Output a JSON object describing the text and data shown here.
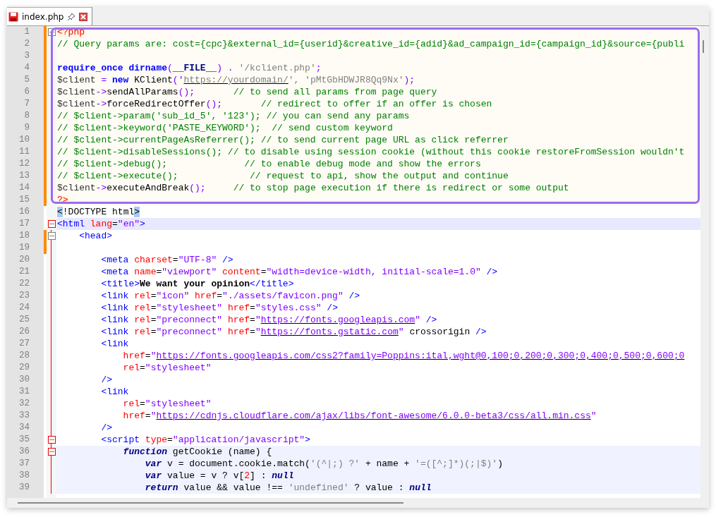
{
  "tab": {
    "label": "index.php",
    "selected": true,
    "modified": true
  },
  "editor": {
    "framed_lines": [
      {
        "num": "1",
        "changed": true,
        "current": false,
        "block": false,
        "fold": true,
        "fold_highlighted": false,
        "tokens": [
          {
            "text": "<?php",
            "kind": "php_tag"
          }
        ]
      },
      {
        "num": "2",
        "changed": true,
        "current": false,
        "block": false,
        "fold": false,
        "tokens": [
          {
            "text": "// Query params are: cost={cpc}&external_id={userid}&creative_id={adid}&ad_campaign_id={campaign_id}&source={publi",
            "kind": "comment"
          }
        ]
      },
      {
        "num": "3",
        "changed": true,
        "current": false,
        "block": false,
        "fold": false
      },
      {
        "num": "4",
        "changed": true,
        "current": false,
        "block": false,
        "fold": false,
        "tokens": [
          {
            "text": "require_once dirname",
            "kind": "kw"
          },
          {
            "text": "(",
            "kind": "op"
          },
          {
            "text": "__FILE__",
            "kind": "const"
          },
          {
            "text": ") . ",
            "kind": "op"
          },
          {
            "text": "'/kclient.php'",
            "kind": "str"
          },
          {
            "text": ";",
            "kind": "op"
          }
        ]
      },
      {
        "num": "5",
        "changed": true,
        "current": false,
        "block": false,
        "fold": false,
        "tokens": [
          {
            "text": "$client",
            "kind": "var"
          },
          {
            "text": " = ",
            "kind": "op"
          },
          {
            "text": "new",
            "kind": "kw"
          },
          {
            "text": " KClient",
            "kind": "plain"
          },
          {
            "text": "('",
            "kind": "op"
          },
          {
            "text": "https://yourdomain/",
            "kind": "str_url"
          },
          {
            "text": "', ",
            "kind": "str"
          },
          {
            "text": "'pMtGbHDWJR8Qq9Nx'",
            "kind": "str"
          },
          {
            "text": ");",
            "kind": "op"
          }
        ]
      },
      {
        "num": "6",
        "changed": true,
        "current": false,
        "block": false,
        "fold": false,
        "tokens": [
          {
            "text": "$client",
            "kind": "var"
          },
          {
            "text": "->",
            "kind": "op"
          },
          {
            "text": "sendAllParams",
            "kind": "plain"
          },
          {
            "text": "();",
            "kind": "op"
          },
          {
            "text": "       // to send all params from page query",
            "kind": "comment"
          }
        ]
      },
      {
        "num": "7",
        "changed": true,
        "current": false,
        "block": false,
        "fold": false,
        "tokens": [
          {
            "text": "$client",
            "kind": "var"
          },
          {
            "text": "->",
            "kind": "op"
          },
          {
            "text": "forceRedirectOffer",
            "kind": "plain"
          },
          {
            "text": "();",
            "kind": "op"
          },
          {
            "text": "       // redirect to offer if an offer is chosen",
            "kind": "comment"
          }
        ]
      },
      {
        "num": "8",
        "changed": true,
        "current": false,
        "block": false,
        "fold": false,
        "tokens": [
          {
            "text": "// $client->param('sub_id_5', '123'); // you can send any params",
            "kind": "comment"
          }
        ]
      },
      {
        "num": "9",
        "changed": true,
        "current": false,
        "block": false,
        "fold": false,
        "tokens": [
          {
            "text": "// $client->keyword('PASTE_KEYWORD');  // send custom keyword",
            "kind": "comment"
          }
        ]
      },
      {
        "num": "10",
        "changed": true,
        "current": false,
        "block": false,
        "fold": false,
        "tokens": [
          {
            "text": "// $client->currentPageAsReferrer(); // to send current page URL as click referrer",
            "kind": "comment"
          }
        ]
      },
      {
        "num": "11",
        "changed": true,
        "current": false,
        "block": false,
        "fold": false,
        "tokens": [
          {
            "text": "// $client->disableSessions(); // to disable using session cookie (without this cookie restoreFromSession wouldn't",
            "kind": "comment"
          }
        ]
      },
      {
        "num": "12",
        "changed": true,
        "current": false,
        "block": false,
        "fold": false,
        "tokens": [
          {
            "text": "// $client->debug();              // to enable debug mode and show the errors",
            "kind": "comment"
          }
        ]
      },
      {
        "num": "13",
        "changed": true,
        "current": false,
        "block": false,
        "fold": false,
        "tokens": [
          {
            "text": "// $client->execute();             // request to api, show the output and continue",
            "kind": "comment"
          }
        ]
      },
      {
        "num": "14",
        "changed": true,
        "current": false,
        "block": false,
        "fold": false,
        "tokens": [
          {
            "text": "$client",
            "kind": "var"
          },
          {
            "text": "->",
            "kind": "op"
          },
          {
            "text": "executeAndBreak",
            "kind": "plain"
          },
          {
            "text": "();",
            "kind": "op"
          },
          {
            "text": "     // to stop page execution if there is redirect or some output",
            "kind": "comment"
          }
        ]
      },
      {
        "num": "15",
        "changed": true,
        "current": false,
        "block": false,
        "fold": false,
        "tokens": [
          {
            "text": "?>",
            "kind": "php_tag"
          }
        ]
      }
    ],
    "lines": [
      {
        "num": "16",
        "changed": false,
        "current": false,
        "block": false,
        "fold": false,
        "tokens": [
          {
            "text": "<",
            "kind": "match"
          },
          {
            "text": "!DOCTYPE html",
            "kind": "plain"
          },
          {
            "text": ">",
            "kind": "match"
          }
        ]
      },
      {
        "num": "17",
        "changed": false,
        "current": true,
        "block": false,
        "fold": true,
        "fold_highlighted": true,
        "tokens": [
          {
            "text": "<html",
            "kind": "tag"
          },
          {
            "text": " lang",
            "kind": "attr"
          },
          {
            "text": "=",
            "kind": "plain"
          },
          {
            "text": "\"en\"",
            "kind": "val"
          },
          {
            "text": ">",
            "kind": "tag"
          }
        ]
      },
      {
        "num": "18",
        "changed": true,
        "current": false,
        "block": false,
        "fold": true,
        "fold_highlighted": false,
        "tokens": [
          {
            "text": "    <head>",
            "kind": "tag"
          }
        ]
      },
      {
        "num": "19",
        "changed": true,
        "current": false,
        "block": false,
        "fold": false
      },
      {
        "num": "20",
        "changed": false,
        "current": false,
        "block": false,
        "fold": false,
        "tokens": [
          {
            "text": "        <meta",
            "kind": "tag"
          },
          {
            "text": " charset",
            "kind": "attr"
          },
          {
            "text": "=",
            "kind": "plain"
          },
          {
            "text": "\"UTF-8\"",
            "kind": "val"
          },
          {
            "text": " />",
            "kind": "tag"
          }
        ]
      },
      {
        "num": "21",
        "changed": false,
        "current": false,
        "block": false,
        "fold": false,
        "tokens": [
          {
            "text": "        <meta",
            "kind": "tag"
          },
          {
            "text": " name",
            "kind": "attr"
          },
          {
            "text": "=",
            "kind": "plain"
          },
          {
            "text": "\"viewport\"",
            "kind": "val"
          },
          {
            "text": " content",
            "kind": "attr"
          },
          {
            "text": "=",
            "kind": "plain"
          },
          {
            "text": "\"width=device-width, initial-scale=1.0\"",
            "kind": "val"
          },
          {
            "text": " />",
            "kind": "tag"
          }
        ]
      },
      {
        "num": "22",
        "changed": false,
        "current": false,
        "block": false,
        "fold": false,
        "tokens": [
          {
            "text": "        <title>",
            "kind": "tag"
          },
          {
            "text": "We want your opinion",
            "kind": "bold"
          },
          {
            "text": "</title>",
            "kind": "tag"
          }
        ]
      },
      {
        "num": "23",
        "changed": false,
        "current": false,
        "block": false,
        "fold": false,
        "tokens": [
          {
            "text": "        <link",
            "kind": "tag"
          },
          {
            "text": " rel",
            "kind": "attr"
          },
          {
            "text": "=",
            "kind": "plain"
          },
          {
            "text": "\"icon\"",
            "kind": "val"
          },
          {
            "text": " href",
            "kind": "attr"
          },
          {
            "text": "=",
            "kind": "plain"
          },
          {
            "text": "\"./assets/favicon.png\"",
            "kind": "val"
          },
          {
            "text": " />",
            "kind": "tag"
          }
        ]
      },
      {
        "num": "24",
        "changed": false,
        "current": false,
        "block": false,
        "fold": false,
        "tokens": [
          {
            "text": "        <link",
            "kind": "tag"
          },
          {
            "text": " rel",
            "kind": "attr"
          },
          {
            "text": "=",
            "kind": "plain"
          },
          {
            "text": "\"stylesheet\"",
            "kind": "val"
          },
          {
            "text": " href",
            "kind": "attr"
          },
          {
            "text": "=",
            "kind": "plain"
          },
          {
            "text": "\"styles.css\"",
            "kind": "val"
          },
          {
            "text": " />",
            "kind": "tag"
          }
        ]
      },
      {
        "num": "25",
        "changed": false,
        "current": false,
        "block": false,
        "fold": false,
        "tokens": [
          {
            "text": "        <link",
            "kind": "tag"
          },
          {
            "text": " rel",
            "kind": "attr"
          },
          {
            "text": "=",
            "kind": "plain"
          },
          {
            "text": "\"preconnect\"",
            "kind": "val"
          },
          {
            "text": " href",
            "kind": "attr"
          },
          {
            "text": "=",
            "kind": "plain"
          },
          {
            "text": "\"",
            "kind": "val"
          },
          {
            "text": "https://fonts.googleapis.com",
            "kind": "url"
          },
          {
            "text": "\"",
            "kind": "val"
          },
          {
            "text": " />",
            "kind": "tag"
          }
        ]
      },
      {
        "num": "26",
        "changed": false,
        "current": false,
        "block": false,
        "fold": false,
        "tokens": [
          {
            "text": "        <link",
            "kind": "tag"
          },
          {
            "text": " rel",
            "kind": "attr"
          },
          {
            "text": "=",
            "kind": "plain"
          },
          {
            "text": "\"preconnect\"",
            "kind": "val"
          },
          {
            "text": " href",
            "kind": "attr"
          },
          {
            "text": "=",
            "kind": "plain"
          },
          {
            "text": "\"",
            "kind": "val"
          },
          {
            "text": "https://fonts.gstatic.com",
            "kind": "url"
          },
          {
            "text": "\"",
            "kind": "val"
          },
          {
            "text": " crossorigin",
            "kind": "plain"
          },
          {
            "text": " />",
            "kind": "tag"
          }
        ]
      },
      {
        "num": "27",
        "changed": false,
        "current": false,
        "block": false,
        "fold": false,
        "tokens": [
          {
            "text": "        <link",
            "kind": "tag"
          }
        ]
      },
      {
        "num": "28",
        "changed": false,
        "current": false,
        "block": false,
        "fold": false,
        "tokens": [
          {
            "text": "            href",
            "kind": "attr"
          },
          {
            "text": "=",
            "kind": "plain"
          },
          {
            "text": "\"",
            "kind": "val"
          },
          {
            "text": "https://fonts.googleapis.com/css2?family=Poppins:ital,wght@0,100;0,200;0,300;0,400;0,500;0,600;0",
            "kind": "url"
          }
        ]
      },
      {
        "num": "29",
        "changed": false,
        "current": false,
        "block": false,
        "fold": false,
        "tokens": [
          {
            "text": "            rel",
            "kind": "attr"
          },
          {
            "text": "=",
            "kind": "plain"
          },
          {
            "text": "\"stylesheet\"",
            "kind": "val"
          }
        ]
      },
      {
        "num": "30",
        "changed": false,
        "current": false,
        "block": false,
        "fold": false,
        "tokens": [
          {
            "text": "        />",
            "kind": "tag"
          }
        ]
      },
      {
        "num": "31",
        "changed": false,
        "current": false,
        "block": false,
        "fold": false,
        "tokens": [
          {
            "text": "        <link",
            "kind": "tag"
          }
        ]
      },
      {
        "num": "32",
        "changed": false,
        "current": false,
        "block": false,
        "fold": false,
        "tokens": [
          {
            "text": "            rel",
            "kind": "attr"
          },
          {
            "text": "=",
            "kind": "plain"
          },
          {
            "text": "\"stylesheet\"",
            "kind": "val"
          }
        ]
      },
      {
        "num": "33",
        "changed": false,
        "current": false,
        "block": false,
        "fold": false,
        "tokens": [
          {
            "text": "            href",
            "kind": "attr"
          },
          {
            "text": "=",
            "kind": "plain"
          },
          {
            "text": "\"",
            "kind": "val"
          },
          {
            "text": "https://cdnjs.cloudflare.com/ajax/libs/font-awesome/6.0.0-beta3/css/all.min.css",
            "kind": "url"
          },
          {
            "text": "\"",
            "kind": "val"
          }
        ]
      },
      {
        "num": "34",
        "changed": false,
        "current": false,
        "block": false,
        "fold": false,
        "tokens": [
          {
            "text": "        />",
            "kind": "tag"
          }
        ]
      },
      {
        "num": "35",
        "changed": false,
        "current": false,
        "block": false,
        "fold": true,
        "fold_highlighted": true,
        "tokens": [
          {
            "text": "        <script",
            "kind": "tag"
          },
          {
            "text": " type",
            "kind": "attr"
          },
          {
            "text": "=",
            "kind": "plain"
          },
          {
            "text": "\"application/javascript\"",
            "kind": "val"
          },
          {
            "text": ">",
            "kind": "tag"
          }
        ]
      },
      {
        "num": "36",
        "changed": false,
        "current": false,
        "block": true,
        "fold": true,
        "fold_highlighted": true,
        "tokens": [
          {
            "text": "            function",
            "kind": "js_kw"
          },
          {
            "text": " getCookie (name) {",
            "kind": "plain"
          }
        ]
      },
      {
        "num": "37",
        "changed": false,
        "current": false,
        "block": true,
        "fold": false,
        "tokens": [
          {
            "text": "                var",
            "kind": "js_kw"
          },
          {
            "text": " v = document.cookie.match(",
            "kind": "plain"
          },
          {
            "text": "'(^|;) ?'",
            "kind": "str"
          },
          {
            "text": " + name + ",
            "kind": "plain"
          },
          {
            "text": "'=([^;]*)(;|$)'",
            "kind": "str"
          },
          {
            "text": ")",
            "kind": "plain"
          }
        ]
      },
      {
        "num": "38",
        "changed": false,
        "current": false,
        "block": true,
        "fold": false,
        "tokens": [
          {
            "text": "                var",
            "kind": "js_kw"
          },
          {
            "text": " value = v ? v[",
            "kind": "plain"
          },
          {
            "text": "2",
            "kind": "num"
          },
          {
            "text": "] : ",
            "kind": "plain"
          },
          {
            "text": "null",
            "kind": "js_kw"
          }
        ]
      },
      {
        "num": "39",
        "changed": false,
        "current": false,
        "block": true,
        "fold": false,
        "tokens": [
          {
            "text": "                return",
            "kind": "js_kw"
          },
          {
            "text": " value && value !== ",
            "kind": "plain"
          },
          {
            "text": "'undefined'",
            "kind": "str"
          },
          {
            "text": " ? value : ",
            "kind": "plain"
          },
          {
            "text": "null",
            "kind": "js_kw"
          }
        ]
      }
    ]
  }
}
